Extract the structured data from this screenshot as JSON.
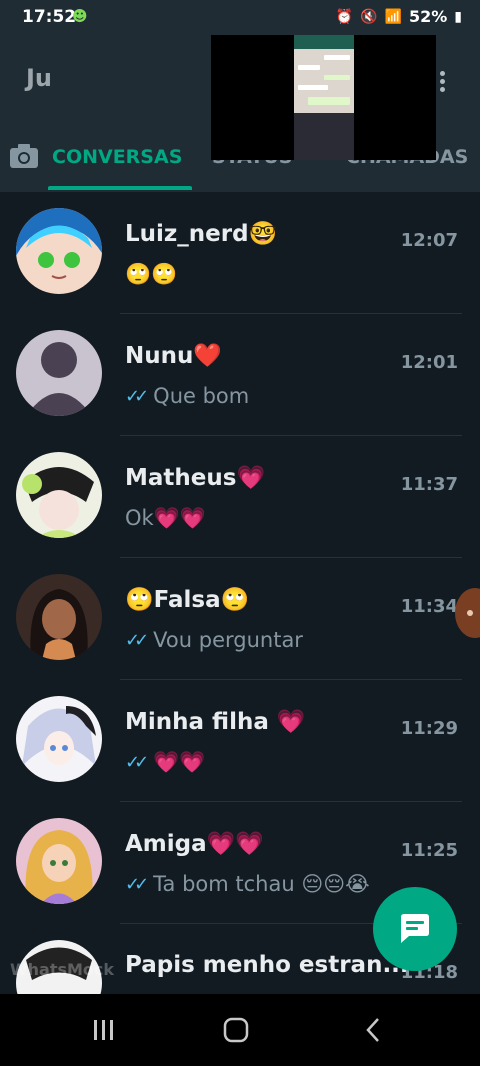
{
  "status_bar": {
    "time": "17:52",
    "battery": "52%"
  },
  "app": {
    "title": "Ju"
  },
  "tabs": [
    {
      "label": "CONVERSAS",
      "active": true
    },
    {
      "label": "STATUS",
      "active": false
    },
    {
      "label": "CHAMADAS",
      "active": false
    }
  ],
  "chats": [
    {
      "name": "Luiz_nerd🤓",
      "time": "12:07",
      "preview": "🙄🙄",
      "read": false
    },
    {
      "name": "Nunu❤️",
      "time": "12:01",
      "preview": "Que bom",
      "read": true
    },
    {
      "name": "Matheus💗",
      "time": "11:37",
      "preview": "Ok💗💗",
      "read": false
    },
    {
      "name": "🙄Falsa🙄",
      "time": "11:34",
      "preview": "Vou perguntar",
      "read": true
    },
    {
      "name": "Minha filha 💗",
      "time": "11:29",
      "preview": "💗💗",
      "read": true
    },
    {
      "name": "Amiga💗💗",
      "time": "11:25",
      "preview": "Ta bom tchau 😔😔😭",
      "read": true
    },
    {
      "name": "Papis menho estran...",
      "time": "11:18",
      "preview": "",
      "read": false
    }
  ],
  "watermark": "WhatsMock",
  "colors": {
    "accent": "#00a884",
    "background": "#121b22",
    "header": "#1f2c34",
    "read_ticks": "#53bdeb"
  }
}
